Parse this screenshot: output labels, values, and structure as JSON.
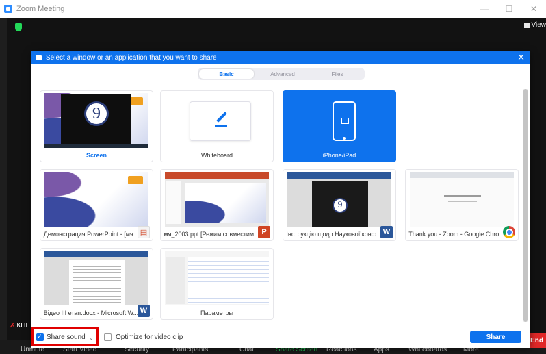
{
  "window": {
    "title": "Zoom Meeting",
    "minimize": "—",
    "maximize": "☐",
    "close": "✕",
    "view_label": "View"
  },
  "dialog": {
    "title": "Select a window or an application that you want to share",
    "close": "✕",
    "tabs": [
      {
        "label": "Basic",
        "active": true
      },
      {
        "label": "Advanced",
        "active": false
      },
      {
        "label": "Files",
        "active": false
      }
    ],
    "tiles": [
      {
        "label": "Screen"
      },
      {
        "label": "Whiteboard"
      },
      {
        "label": "iPhone/iPad"
      },
      {
        "label": "Демонстрация PowerPoint - [мя..."
      },
      {
        "label": "мя_2003.ppt [Режим совместим..."
      },
      {
        "label": "Інструкцію щодо Наукової конф..."
      },
      {
        "label": "Thank you - Zoom - Google Chro..."
      },
      {
        "label": "Відео III етап.docx - Microsoft W..."
      },
      {
        "label": "Параметры"
      }
    ],
    "thumb_number": "9",
    "badges": {
      "word": "W",
      "ppt": "P"
    },
    "share_sound": "Share sound",
    "share_sound_checked": true,
    "optimize": "Optimize for video clip",
    "optimize_checked": false,
    "share_button": "Share"
  },
  "participant_label": "КПІ",
  "toolbar": {
    "items": [
      "Unmute",
      "Start Video",
      "Security",
      "Participants",
      "Chat",
      "Share Screen",
      "Reactions",
      "Apps",
      "Whiteboards",
      "More"
    ],
    "end": "End"
  },
  "colors": {
    "accent": "#0e72ed",
    "share_screen": "#23d959",
    "end": "#e02828",
    "highlight_box": "#e00000"
  }
}
